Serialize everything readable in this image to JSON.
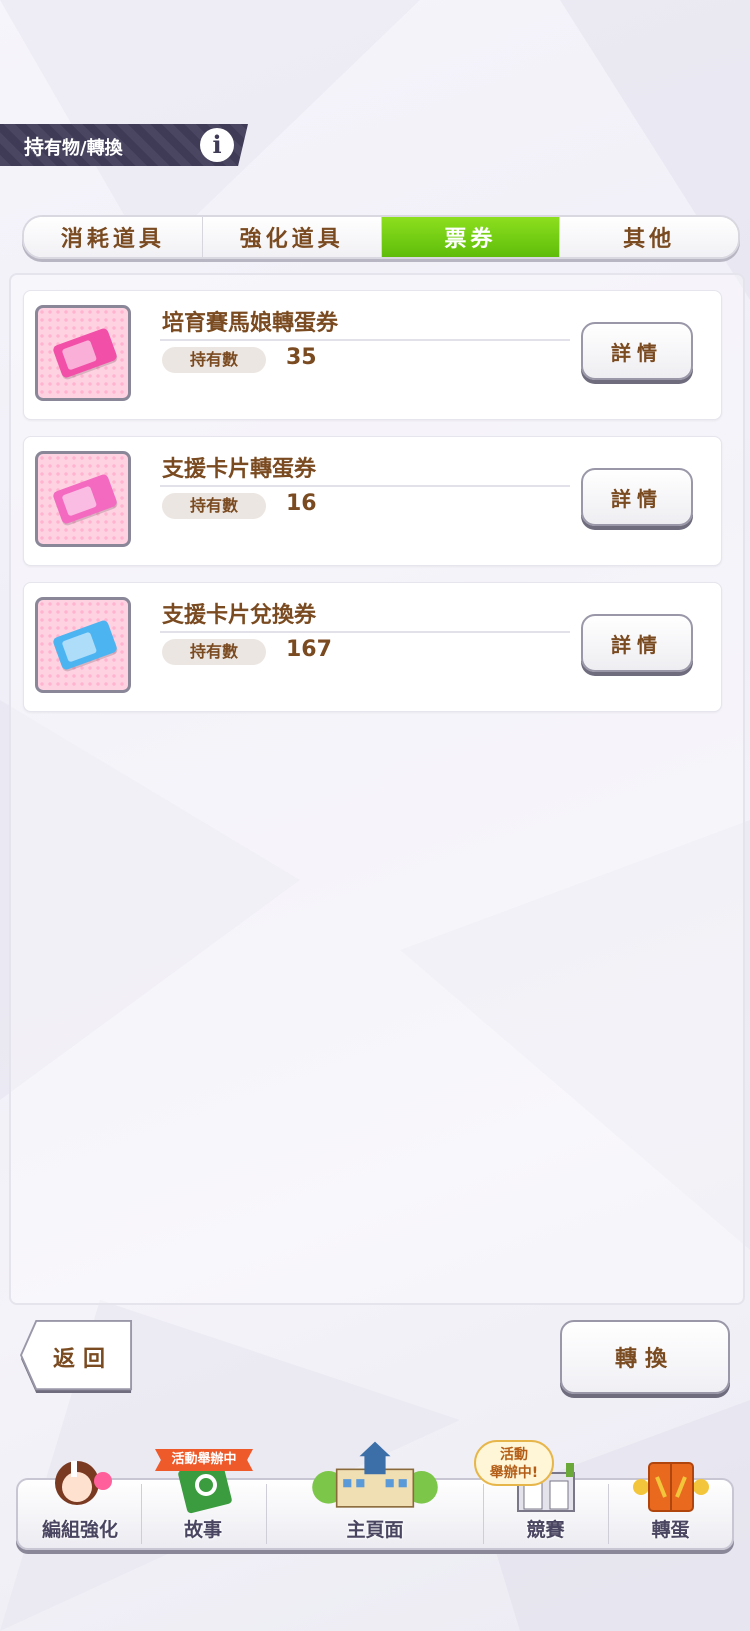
{
  "header": {
    "title_main": "持",
    "title_rest": "有物/轉換",
    "info_label": "i"
  },
  "tabs": [
    {
      "label": "消耗道具",
      "active": false
    },
    {
      "label": "強化道具",
      "active": false
    },
    {
      "label": "票券",
      "active": true
    },
    {
      "label": "其他",
      "active": false
    }
  ],
  "items": [
    {
      "name": "培育賽馬娘轉蛋券",
      "owned_label": "持有數",
      "count": "35",
      "detail_label": "詳情",
      "ticket_color": "#f24fa8"
    },
    {
      "name": "支援卡片轉蛋券",
      "owned_label": "持有數",
      "count": "16",
      "detail_label": "詳情",
      "ticket_color": "#f36ac0"
    },
    {
      "name": "支援卡片兌換券",
      "owned_label": "持有數",
      "count": "167",
      "detail_label": "詳情",
      "ticket_color": "#4db4f2"
    }
  ],
  "buttons": {
    "back_label": "返回",
    "convert_label": "轉換"
  },
  "nav": {
    "items": [
      {
        "label": "編組強化"
      },
      {
        "label": "故事"
      },
      {
        "label": "主頁面"
      },
      {
        "label": "競賽"
      },
      {
        "label": "轉蛋"
      }
    ],
    "story_badge": "活動舉辦中",
    "race_badge_line1": "活動",
    "race_badge_line2": "舉辦中!"
  },
  "colors": {
    "accent_green": "#6cc513",
    "text_brown": "#7a4a20",
    "header_dark": "#443f5a"
  }
}
